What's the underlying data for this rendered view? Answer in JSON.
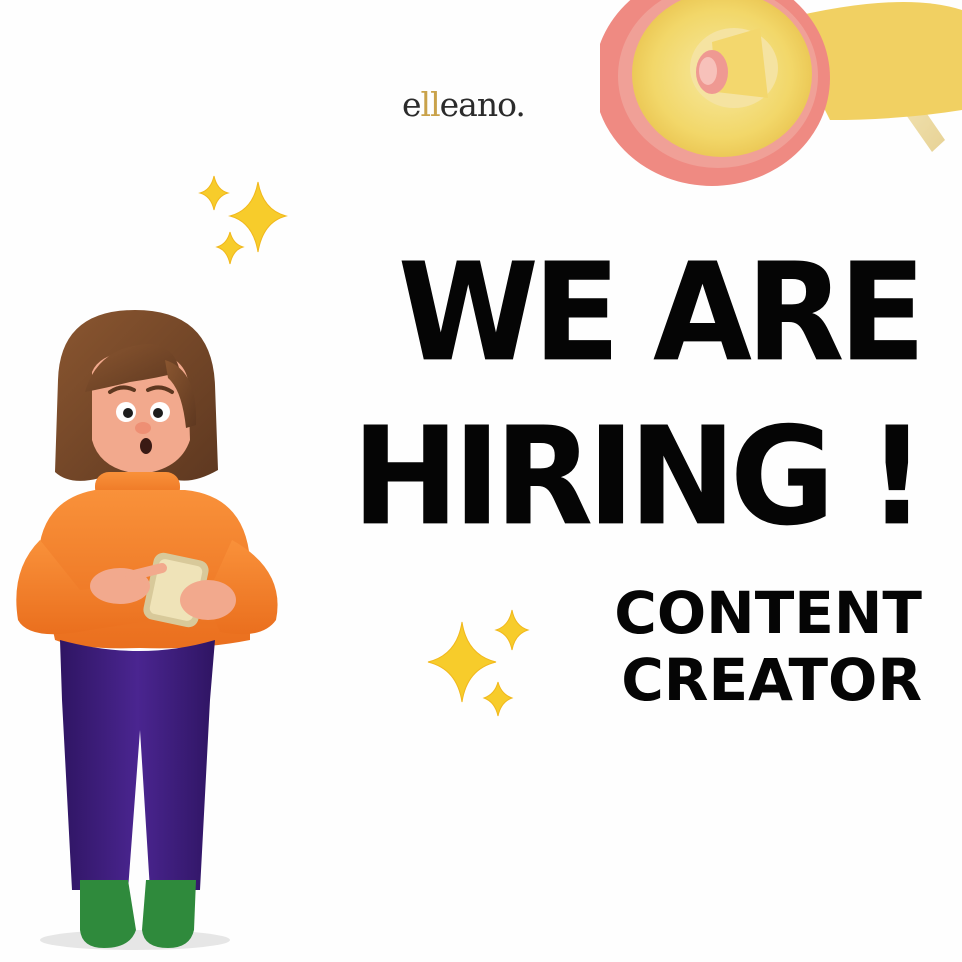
{
  "brand": {
    "logo_main_before": "e",
    "logo_accent": "ll",
    "logo_main_after": "eano."
  },
  "headline": {
    "line1": "WE ARE",
    "line2": "HIRING !"
  },
  "role": {
    "line1": "CONTENT",
    "line2": "CREATOR"
  },
  "colors": {
    "background": "#fefefe",
    "text": "#050505",
    "logo_accent": "#c9a24a",
    "sparkle": "#f7cc2b",
    "sweater": "#f47f2a",
    "pants": "#3e1f7a",
    "shoes": "#2f8a3c",
    "hair": "#7a4a2b",
    "megaphone_body": "#f3dd6e",
    "megaphone_rim": "#ef8a82"
  },
  "icons": [
    "megaphone-icon",
    "sparkles-icon",
    "character-illustration"
  ]
}
